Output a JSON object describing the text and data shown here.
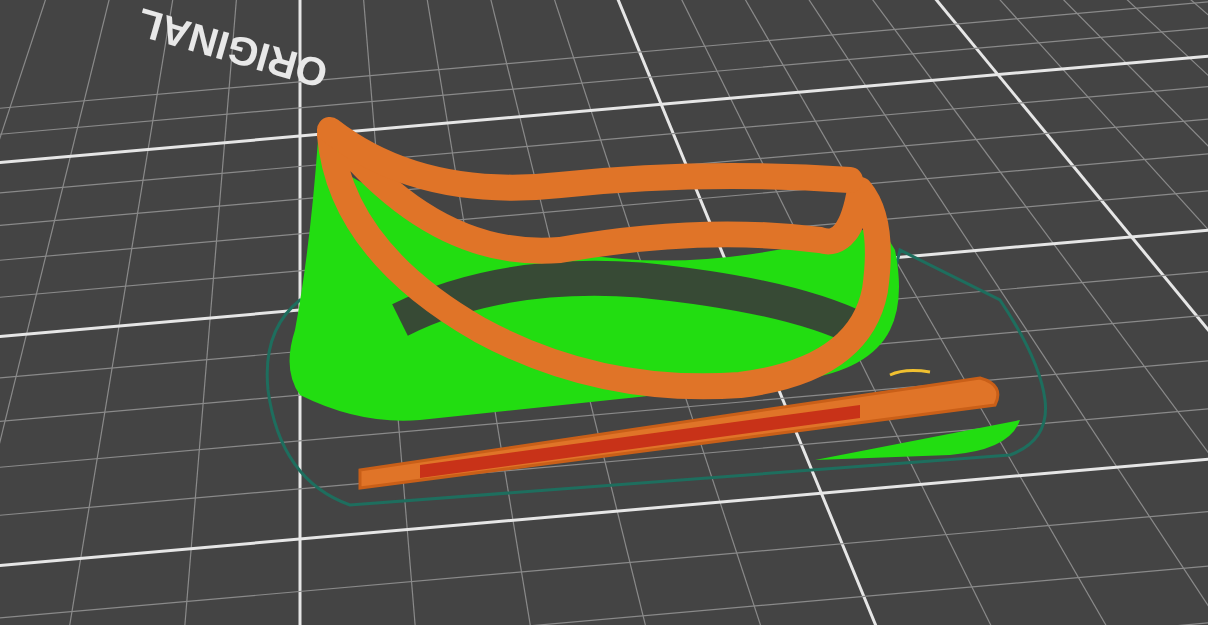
{
  "viewport": {
    "bed_label": "ORIGINAL"
  }
}
